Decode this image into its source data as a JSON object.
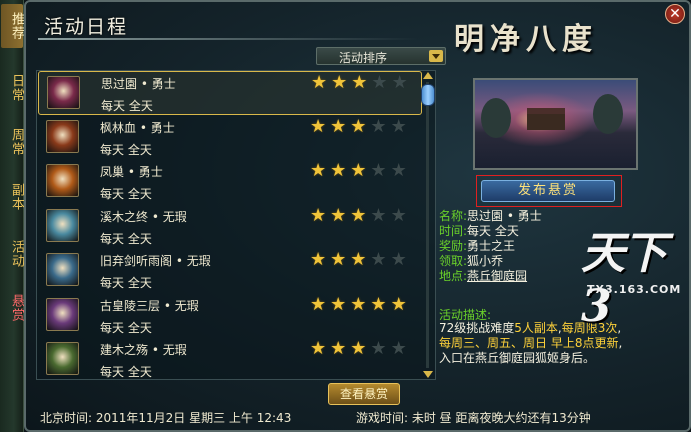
{
  "side_tabs": [
    {
      "label": "推荐",
      "style": "active"
    },
    {
      "label": "日常",
      "style": ""
    },
    {
      "label": "周常",
      "style": ""
    },
    {
      "label": "副本",
      "style": ""
    },
    {
      "label": "活动",
      "style": ""
    },
    {
      "label": "悬赏",
      "style": "red"
    }
  ],
  "window": {
    "title": "活动日程",
    "brand_title": "明净八度",
    "close_label": "✕"
  },
  "sort": {
    "label": "活动排序"
  },
  "activities": [
    {
      "name": "思过園 • 勇士",
      "time": "每天  全天",
      "stars": 3,
      "icon_color": "#7a2a4a",
      "selected": true
    },
    {
      "name": "枫林血 • 勇士",
      "time": "每天  全天",
      "stars": 3,
      "icon_color": "#8a3a1a",
      "selected": false
    },
    {
      "name": "凤巢 • 勇士",
      "time": "每天  全天",
      "stars": 3,
      "icon_color": "#b05a18",
      "selected": false
    },
    {
      "name": "溪木之终 • 无瑕",
      "time": "每天  全天",
      "stars": 3,
      "icon_color": "#4a8aa0",
      "selected": false
    },
    {
      "name": "旧弃剑听雨阁 • 无瑕",
      "time": "每天  全天",
      "stars": 3,
      "icon_color": "#3a6a8a",
      "selected": false
    },
    {
      "name": "古皇陵三层 • 无瑕",
      "time": "每天  全天",
      "stars": 5,
      "icon_color": "#6a3a7a",
      "selected": false
    },
    {
      "name": "建木之殇 • 无瑕",
      "time": "每天  全天",
      "stars": 3,
      "icon_color": "#4a6a30",
      "selected": false
    }
  ],
  "view_bounty_label": "查看悬赏",
  "post_bounty_label": "发布悬赏",
  "details": [
    {
      "key": "名称:",
      "value": "思过園 • 勇士",
      "underline": false
    },
    {
      "key": "时间:",
      "value": "每天  全天",
      "underline": false
    },
    {
      "key": "奖励:",
      "value": "勇士之王",
      "underline": false
    },
    {
      "key": "领取:",
      "value": "狐小乔",
      "underline": false
    },
    {
      "key": "地点:",
      "value": "燕丘御庭园",
      "underline": true
    }
  ],
  "description": {
    "title": "活动描述:",
    "line1_a": "72级挑战难度",
    "line1_b": "5人副本",
    "line1_c": ",",
    "line1_d": "每周限3次",
    "line1_e": ",",
    "line2": "每周三、周五、周日 早上8点更新",
    "line2_end": ",",
    "line3": "入口在燕丘御庭园狐姬身后。"
  },
  "logo": {
    "main": "天下3",
    "url": "TX3.163.COM"
  },
  "status": {
    "beijing_time": "北京时间: 2011年11月2日  星期三  上午 12:43",
    "game_time": "游戏时间: 未时  昼  距离夜晚大约还有13分钟"
  },
  "colors": {
    "gold": "#f0c43a",
    "green_key": "#6ad02a",
    "highlight": "#ffd23a",
    "red_frame": "#e02020"
  }
}
